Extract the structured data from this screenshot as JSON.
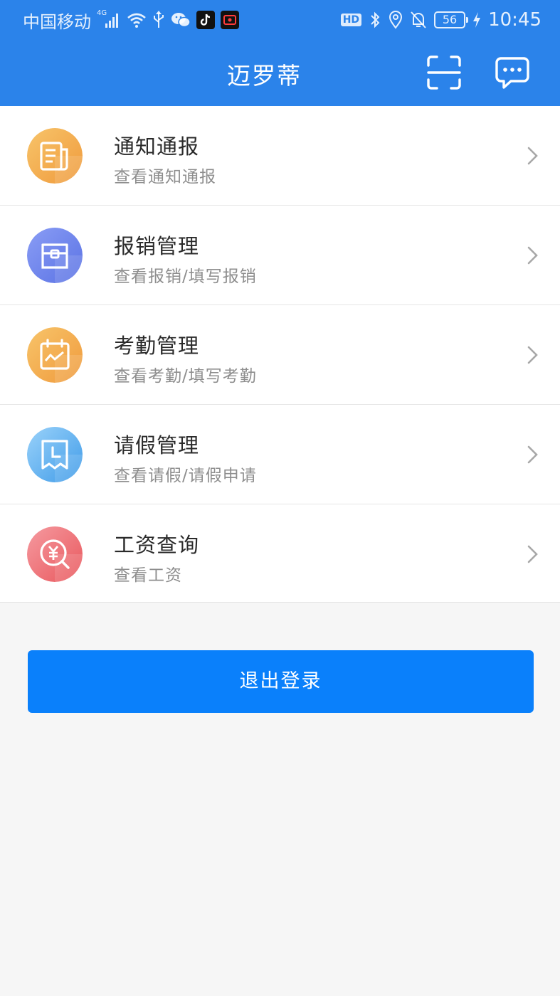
{
  "status_bar": {
    "carrier": "中国移动",
    "network": "4G",
    "hd_badge": "HD",
    "battery": "56",
    "time": "10:45"
  },
  "header": {
    "title": "迈罗蒂",
    "scan_icon": "scan-icon",
    "chat_icon": "chat-icon"
  },
  "menu": {
    "items": [
      {
        "title": "通知通报",
        "subtitle": "查看通知通报",
        "icon": "notice-document-icon",
        "color": "#f0a448"
      },
      {
        "title": "报销管理",
        "subtitle": "查看报销/填写报销",
        "icon": "reimbursement-box-icon",
        "color": "#6f85ec"
      },
      {
        "title": "考勤管理",
        "subtitle": "查看考勤/填写考勤",
        "icon": "attendance-calendar-icon",
        "color": "#f0a448"
      },
      {
        "title": "请假管理",
        "subtitle": "查看请假/请假申请",
        "icon": "leave-clock-icon",
        "color": "#5ab0f0"
      },
      {
        "title": "工资查询",
        "subtitle": "查看工资",
        "icon": "salary-yen-icon",
        "color": "#ef7173"
      }
    ]
  },
  "logout_label": "退出登录",
  "colors": {
    "header_bg": "#2b83ea",
    "button_bg": "#0a80fb",
    "page_bg": "#f6f6f6"
  }
}
